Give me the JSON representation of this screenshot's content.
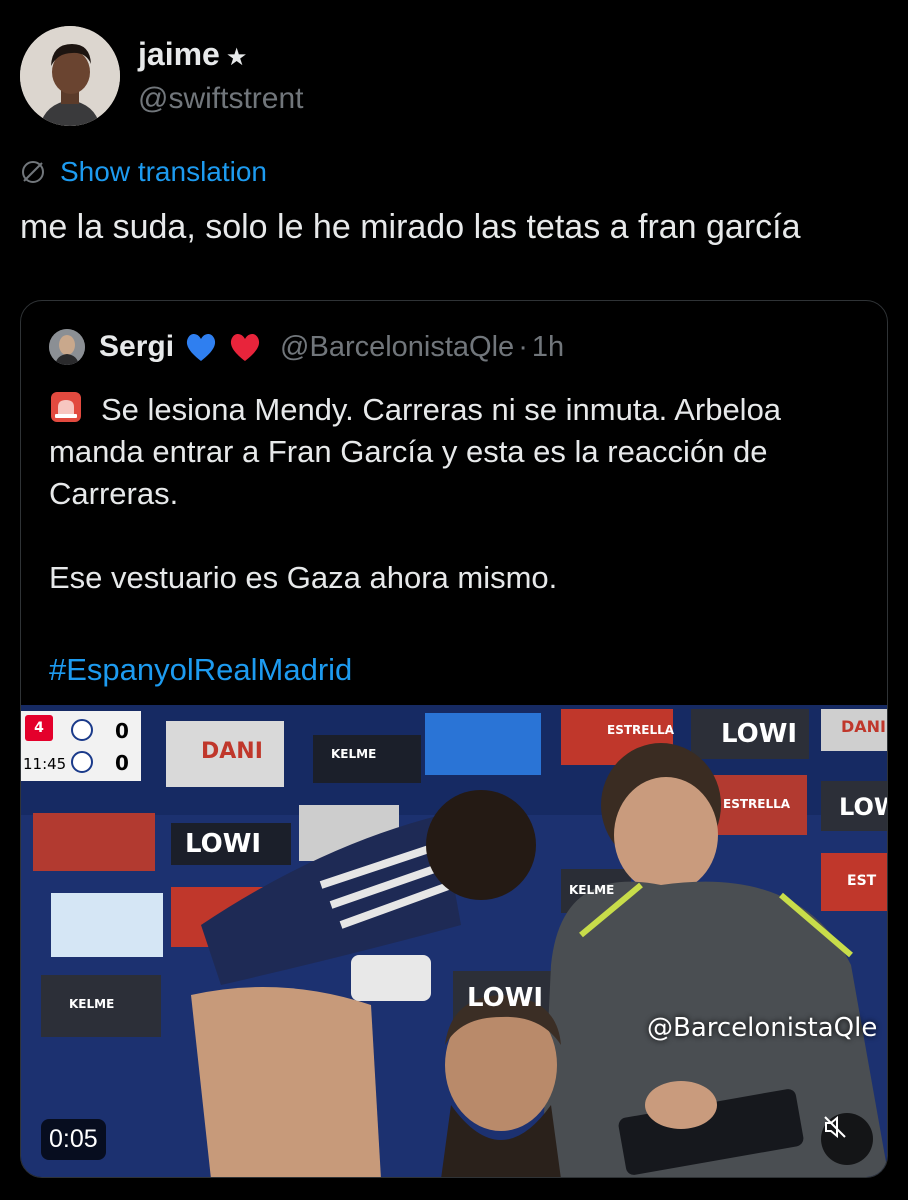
{
  "author": {
    "name": "jaime",
    "badge": "★",
    "handle": "@swiftstrent",
    "avatar_icon": "profile-photo"
  },
  "translation": {
    "icon": "globe-icon",
    "label": "Show translation"
  },
  "tweet": {
    "text": "me la suda, solo le he mirado las tetas a fran garcía"
  },
  "quoted_tweet": {
    "name": "Sergi",
    "emojis": [
      "blue-heart",
      "red-heart"
    ],
    "handle": "@BarcelonistaQle",
    "separator": "·",
    "time": "1h",
    "siren_icon": "police-light-icon",
    "text_line1": "Se lesiona Mendy. Carreras ni se inmuta. Arbeloa manda entrar a Fran García y esta es la reacción de Carreras.",
    "text_line2": "Ese vestuario es Gaza ahora mismo.",
    "hashtag": "#EspanyolRealMadrid",
    "video": {
      "scoreboard": {
        "league_logo": "4",
        "clock": "11:45",
        "home_score": "0",
        "away_score": "0"
      },
      "ads": [
        "DANI",
        "KELME",
        "LOWI",
        "ESTRELLA",
        "LOWI",
        "KELME",
        "LOWI",
        "ESTRELLA",
        "DANI",
        "KELME",
        "LOW",
        "EST"
      ],
      "watermark": "@BarcelonistaQle",
      "duration": "0:05",
      "mute_icon": "volume-muted-icon"
    }
  },
  "colors": {
    "background": "#000000",
    "text": "#e7e9ea",
    "secondary": "#71767b",
    "link": "#1d9bf0",
    "border": "#2f3336"
  }
}
